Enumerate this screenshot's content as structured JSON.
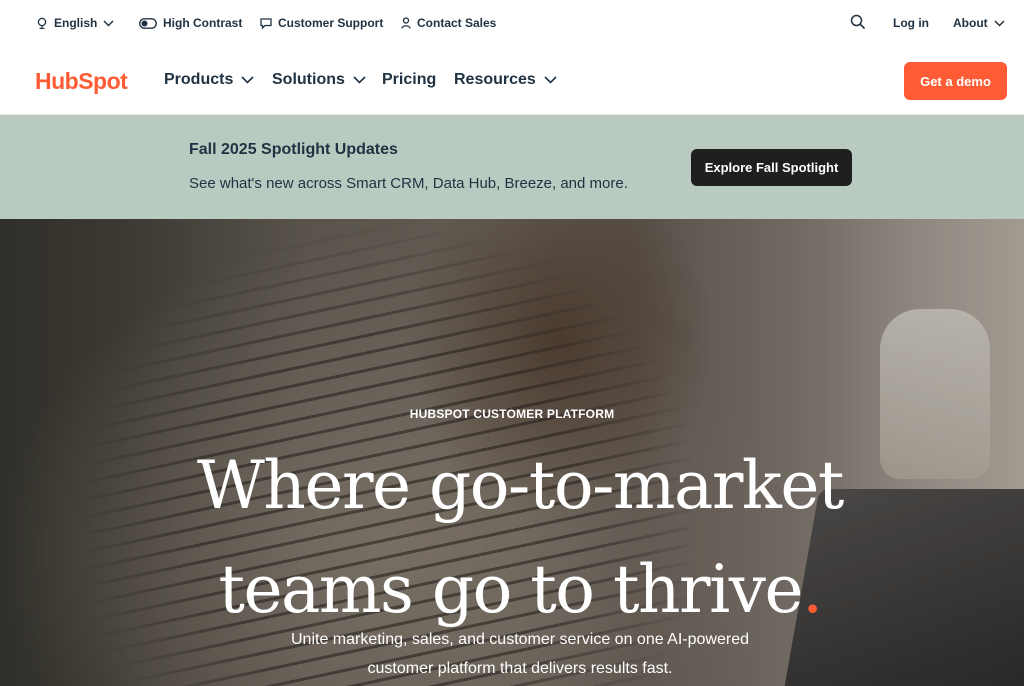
{
  "utility": {
    "language": "English",
    "high_contrast": "High Contrast",
    "customer_support": "Customer Support",
    "contact_sales": "Contact Sales",
    "login": "Log in",
    "about": "About"
  },
  "nav": {
    "logo": "HubSpot",
    "items": [
      {
        "label": "Products",
        "has_menu": true
      },
      {
        "label": "Solutions",
        "has_menu": true
      },
      {
        "label": "Pricing",
        "has_menu": false
      },
      {
        "label": "Resources",
        "has_menu": true
      }
    ],
    "cta": "Get a demo"
  },
  "banner": {
    "title": "Fall 2025 Spotlight Updates",
    "text": "See what's new across Smart CRM, Data Hub, Breeze, and more.",
    "button": "Explore Fall Spotlight"
  },
  "hero": {
    "eyebrow": "HUBSPOT CUSTOMER PLATFORM",
    "headline_line1": "Where go-to-market",
    "headline_line2": "teams go to thrive",
    "headline_dot": ".",
    "subtext_line1": "Unite marketing, sales, and customer service on one AI-powered",
    "subtext_line2": "customer platform that delivers results fast."
  },
  "colors": {
    "brand_orange": "#ff5c35",
    "navy": "#213343",
    "banner_bg": "#b9cbc0"
  },
  "icons": [
    "globe-icon",
    "chevron-down-icon",
    "contrast-toggle-icon",
    "chat-icon",
    "person-icon",
    "search-icon"
  ]
}
